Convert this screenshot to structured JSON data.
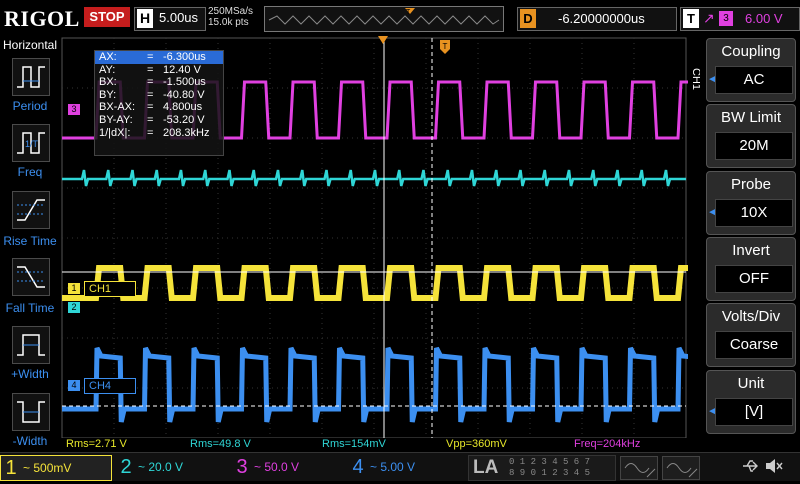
{
  "brand": "RIGOL",
  "run_status": "STOP",
  "timebase": {
    "label": "H",
    "value": "5.00us"
  },
  "sample": {
    "rate": "250MSa/s",
    "points": "15.0k pts"
  },
  "delay": {
    "label": "D",
    "value": "-6.20000000us"
  },
  "trigger": {
    "label": "T",
    "edge": "rising",
    "source": "3",
    "level": "6.00 V"
  },
  "left_menu": {
    "title": "Horizontal",
    "items": [
      {
        "label": "Period"
      },
      {
        "label": "Freq"
      },
      {
        "label": "Rise Time"
      },
      {
        "label": "Fall Time"
      },
      {
        "label": "+Width"
      },
      {
        "label": "-Width"
      }
    ]
  },
  "cursor_table": [
    {
      "key": "AX:",
      "value": "-6.300us"
    },
    {
      "key": "AY:",
      "value": "12.40 V"
    },
    {
      "key": "BX:",
      "value": "-1.500us"
    },
    {
      "key": "BY:",
      "value": "-40.80 V"
    },
    {
      "key": "BX-AX:",
      "value": "4.800us"
    },
    {
      "key": "BY-AY:",
      "value": "-53.20 V"
    },
    {
      "key": "1/|dX|:",
      "value": "208.3kHz"
    }
  ],
  "channel_tags": {
    "ch1": "CH1",
    "ch4": "CH4"
  },
  "channel_markers": {
    "m1": "1",
    "m2": "2",
    "m3": "3",
    "m4": "4"
  },
  "right_menu": {
    "channel": "CH1",
    "items": [
      {
        "title": "Coupling",
        "value": "AC"
      },
      {
        "title": "BW Limit",
        "value": "20M"
      },
      {
        "title": "Probe",
        "value": "10X"
      },
      {
        "title": "Invert",
        "value": "OFF"
      },
      {
        "title": "Volts/Div",
        "value": "Coarse"
      },
      {
        "title": "Unit",
        "value": "[V]"
      }
    ]
  },
  "measurements": [
    {
      "text": "Rms=2.71 V",
      "color": "#e8e82a"
    },
    {
      "text": "Rms=49.8 V",
      "color": "#2fd6d6"
    },
    {
      "text": "Rms=154mV",
      "color": "#2fd6d6"
    },
    {
      "text": "Vpp=360mV",
      "color": "#e8e82a"
    },
    {
      "text": "Freq=204kHz",
      "color": "#e040e0"
    }
  ],
  "channels": [
    {
      "num": "1",
      "scale": "500mV",
      "color": "#f5e33a"
    },
    {
      "num": "2",
      "scale": "20.0 V",
      "color": "#2fd6d6"
    },
    {
      "num": "3",
      "scale": "50.0 V",
      "color": "#e040e0"
    },
    {
      "num": "4",
      "scale": "5.00 V",
      "color": "#3c8ff0"
    }
  ],
  "la": {
    "label": "LA",
    "digits_row1": "0 1 2 3  4 5 6 7",
    "digits_row2": "8 9 0 1  2 3 4 5"
  },
  "colors": {
    "ch1": "#f5e33a",
    "ch2": "#2fd6d6",
    "ch3": "#e040e0",
    "ch4": "#3c8ff0",
    "accent": "#e89220"
  }
}
